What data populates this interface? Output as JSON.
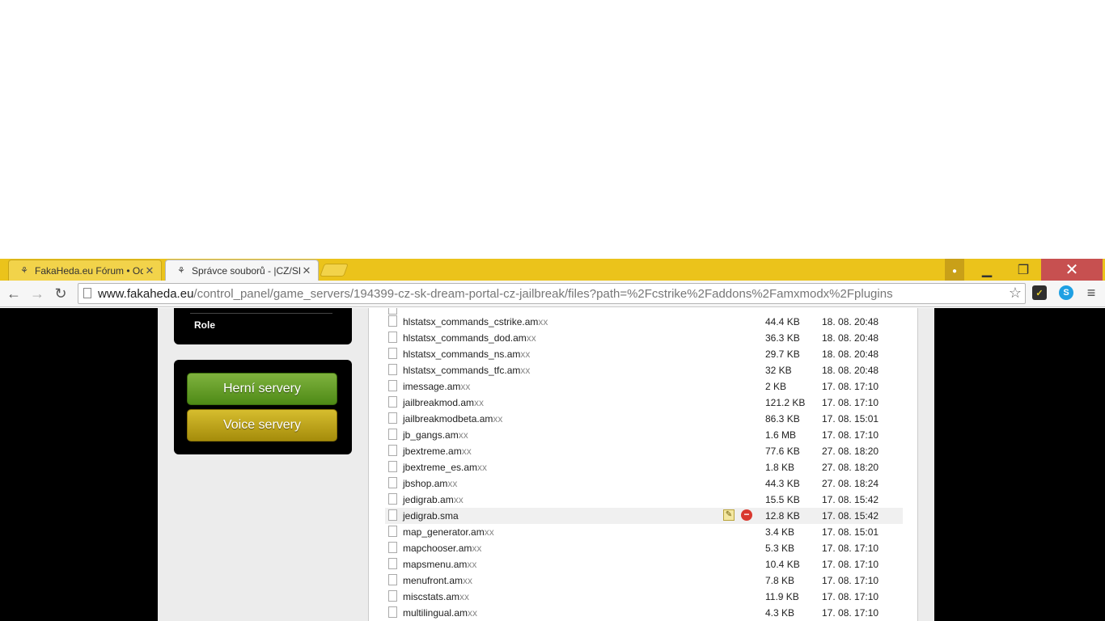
{
  "browser": {
    "tabs": [
      {
        "title": "FakaHeda.eu Fórum • Ode",
        "active": false
      },
      {
        "title": "Správce souborů - |CZ/SK|",
        "active": true
      }
    ],
    "url_host": "www.fakaheda.eu",
    "url_path": "/control_panel/game_servers/194399-cz-sk-dream-portal-cz-jailbreak/files?path=%2Fcstrike%2Faddons%2Famxmodx%2Fplugins",
    "close_glyph": "✕"
  },
  "sidebar": {
    "role_label": "Role",
    "herni_label": "Herní servery",
    "voice_label": "Voice servery"
  },
  "files": [
    {
      "name": "hlstatsx_commands_cstrike.am",
      "ext": "xx",
      "size": "44.4 KB",
      "date": "18. 08. 20:48"
    },
    {
      "name": "hlstatsx_commands_dod.am",
      "ext": "xx",
      "size": "36.3 KB",
      "date": "18. 08. 20:48"
    },
    {
      "name": "hlstatsx_commands_ns.am",
      "ext": "xx",
      "size": "29.7 KB",
      "date": "18. 08. 20:48"
    },
    {
      "name": "hlstatsx_commands_tfc.am",
      "ext": "xx",
      "size": "32 KB",
      "date": "18. 08. 20:48"
    },
    {
      "name": "imessage.am",
      "ext": "xx",
      "size": "2 KB",
      "date": "17. 08. 17:10"
    },
    {
      "name": "jailbreakmod.am",
      "ext": "xx",
      "size": "121.2 KB",
      "date": "17. 08. 17:10"
    },
    {
      "name": "jailbreakmodbeta.am",
      "ext": "xx",
      "size": "86.3 KB",
      "date": "17. 08. 15:01"
    },
    {
      "name": "jb_gangs.am",
      "ext": "xx",
      "size": "1.6 MB",
      "date": "17. 08. 17:10"
    },
    {
      "name": "jbextreme.am",
      "ext": "xx",
      "size": "77.6 KB",
      "date": "27. 08. 18:20"
    },
    {
      "name": "jbextreme_es.am",
      "ext": "xx",
      "size": "1.8 KB",
      "date": "27. 08. 18:20"
    },
    {
      "name": "jbshop.am",
      "ext": "xx",
      "size": "44.3 KB",
      "date": "27. 08. 18:24"
    },
    {
      "name": "jedigrab.am",
      "ext": "xx",
      "size": "15.5 KB",
      "date": "17. 08. 15:42"
    },
    {
      "name": "jedigrab.sma",
      "ext": "",
      "size": "12.8 KB",
      "date": "17. 08. 15:42"
    },
    {
      "name": "map_generator.am",
      "ext": "xx",
      "size": "3.4 KB",
      "date": "17. 08. 15:01"
    },
    {
      "name": "mapchooser.am",
      "ext": "xx",
      "size": "5.3 KB",
      "date": "17. 08. 17:10"
    },
    {
      "name": "mapsmenu.am",
      "ext": "xx",
      "size": "10.4 KB",
      "date": "17. 08. 17:10"
    },
    {
      "name": "menufront.am",
      "ext": "xx",
      "size": "7.8 KB",
      "date": "17. 08. 17:10"
    },
    {
      "name": "miscstats.am",
      "ext": "xx",
      "size": "11.9 KB",
      "date": "17. 08. 17:10"
    },
    {
      "name": "multilingual.am",
      "ext": "xx",
      "size": "4.3 KB",
      "date": "17. 08. 17:10"
    }
  ]
}
